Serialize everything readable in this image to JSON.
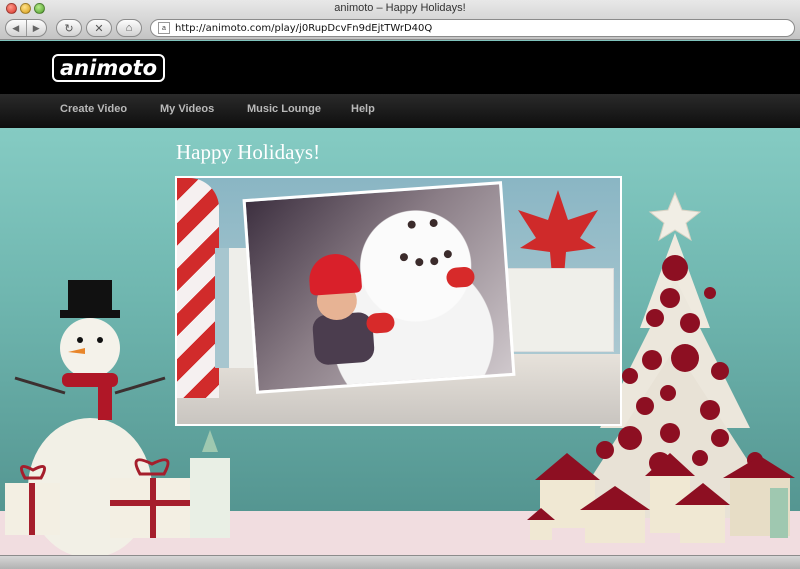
{
  "window": {
    "title": "animoto – Happy Holidays!",
    "url": "http://animoto.com/play/j0RupDcvFn9dEjtTWrD40Q"
  },
  "toolbar": {
    "back_icon": "back-arrow-icon",
    "forward_icon": "forward-arrow-icon",
    "reload_icon": "reload-icon",
    "stop_icon": "stop-icon",
    "home_icon": "home-icon"
  },
  "site": {
    "logo": "animoto",
    "nav": [
      {
        "label": "Create Video"
      },
      {
        "label": "My Videos"
      },
      {
        "label": "Music Lounge"
      },
      {
        "label": "Help"
      }
    ]
  },
  "main": {
    "title": "Happy Holidays!"
  },
  "colors": {
    "background_teal": "#7fc4bd",
    "header_black": "#000000",
    "accent_red": "#8d0f22",
    "floor_pink": "#f1dde0"
  }
}
